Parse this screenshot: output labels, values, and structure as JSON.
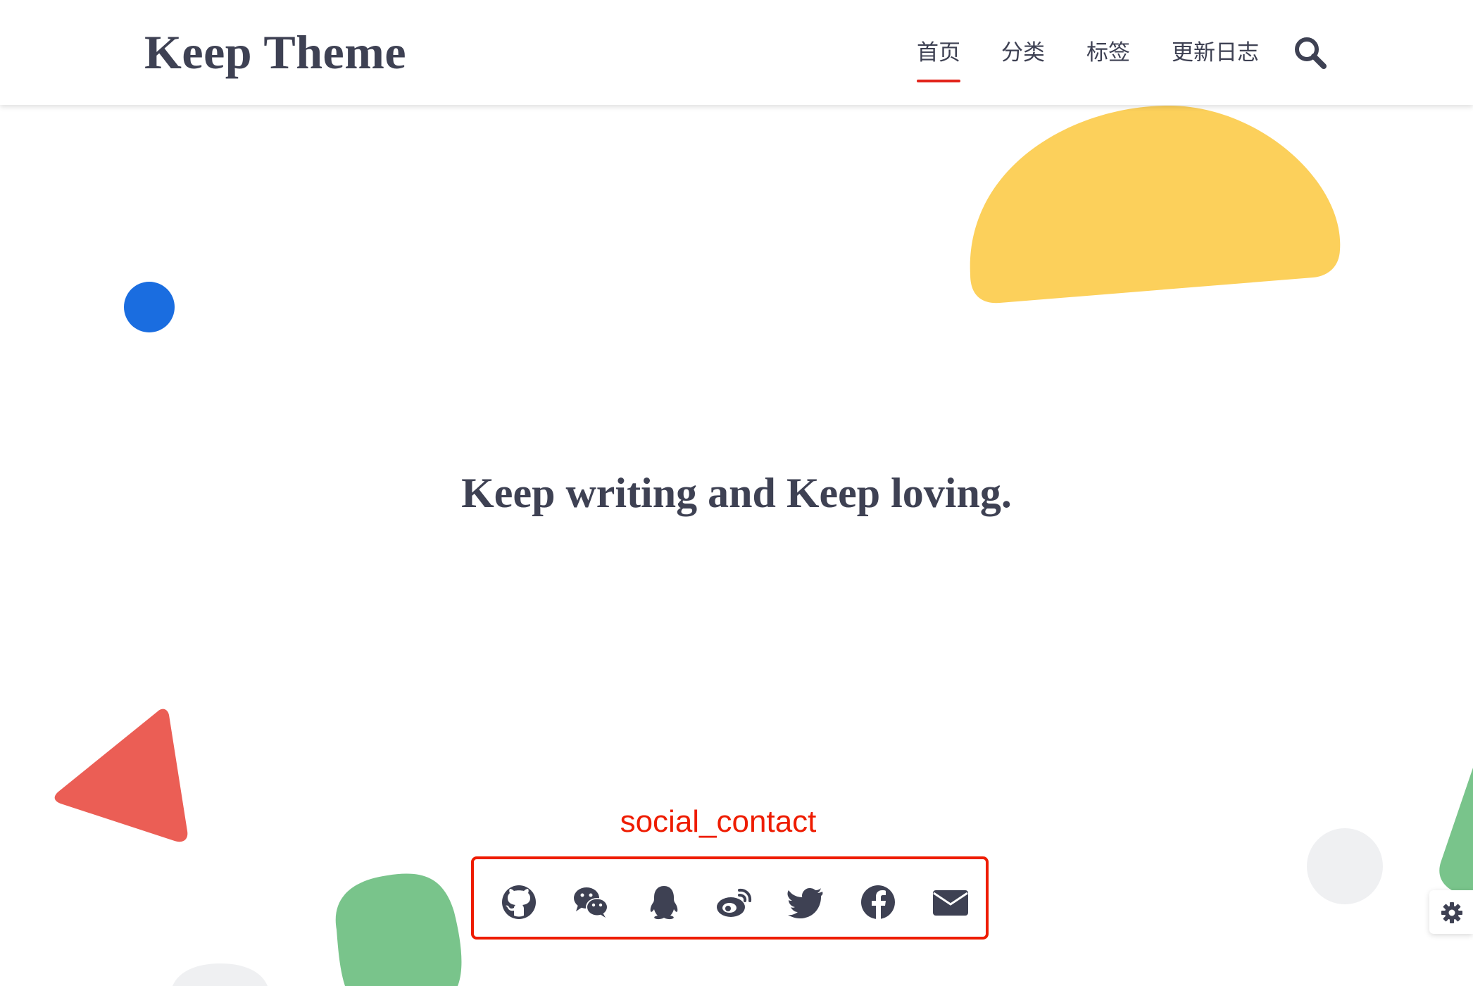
{
  "header": {
    "logo": "Keep Theme",
    "nav": [
      {
        "label": "首页",
        "active": true
      },
      {
        "label": "分类",
        "active": false
      },
      {
        "label": "标签",
        "active": false
      },
      {
        "label": "更新日志",
        "active": false
      }
    ],
    "search_icon": "search-icon"
  },
  "hero": {
    "slogan": "Keep writing and Keep loving."
  },
  "annotation": {
    "label": "social_contact",
    "color": "#ee1c00"
  },
  "social": {
    "icons": [
      "github-icon",
      "wechat-icon",
      "qq-icon",
      "weibo-icon",
      "twitter-icon",
      "facebook-icon",
      "email-icon"
    ]
  },
  "settings": {
    "icon": "gear-icon"
  },
  "colors": {
    "text": "#3e4153",
    "accent": "#e2231a",
    "yellow": "#fcd05b",
    "blue": "#1a6de0",
    "red": "#eb5e55",
    "green": "#79c48b",
    "grey": "#eff0f2"
  }
}
